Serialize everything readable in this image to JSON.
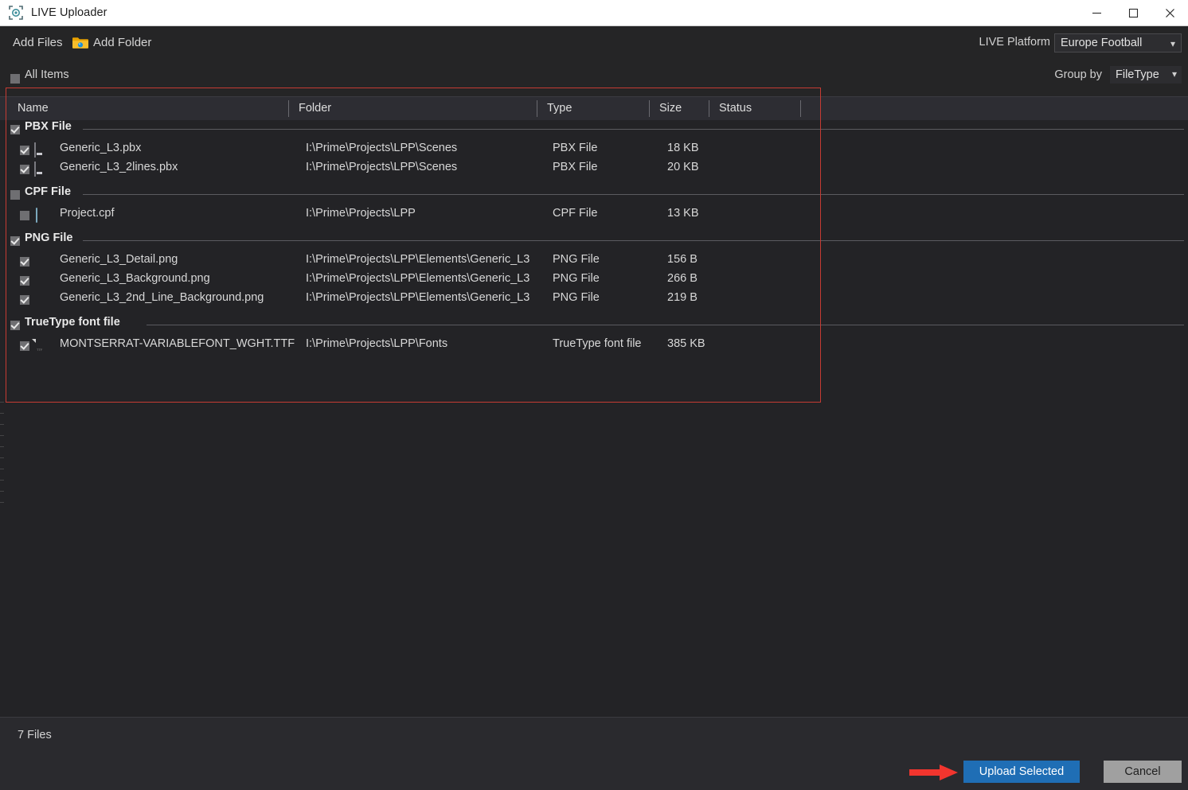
{
  "window": {
    "title": "LIVE Uploader",
    "app_icon": "viewfinder-icon",
    "minimize_label": "Minimize",
    "maximize_label": "Maximize",
    "close_label": "Close"
  },
  "toolbar": {
    "add_files_label": "Add Files",
    "add_folder_label": "Add Folder",
    "folder_icon": "folder-icon",
    "live_platform_label": "LIVE Platform",
    "live_platform_value": "Europe Football"
  },
  "filters": {
    "all_items_label": "All Items",
    "all_items_checked": false,
    "group_by_label": "Group by",
    "group_by_value": "FileType"
  },
  "table": {
    "columns": [
      "Name",
      "Folder",
      "Type",
      "Size",
      "Status"
    ],
    "groups": [
      {
        "label": "PBX File",
        "checked": true,
        "rows": [
          {
            "icon": "pbx-file-icon",
            "checked": true,
            "name": "Generic_L3.pbx",
            "folder": "I:\\Prime\\Projects\\LPP\\Scenes",
            "type": "PBX File",
            "size": "18 KB",
            "status": ""
          },
          {
            "icon": "pbx-file-icon",
            "checked": true,
            "name": "Generic_L3_2lines.pbx",
            "folder": "I:\\Prime\\Projects\\LPP\\Scenes",
            "type": "PBX File",
            "size": "20 KB",
            "status": ""
          }
        ]
      },
      {
        "label": "CPF File",
        "checked": false,
        "rows": [
          {
            "icon": "cpf-file-icon",
            "checked": false,
            "name": "Project.cpf",
            "folder": "I:\\Prime\\Projects\\LPP",
            "type": "CPF File",
            "size": "13 KB",
            "status": ""
          }
        ]
      },
      {
        "label": "PNG File",
        "checked": true,
        "rows": [
          {
            "icon": "png-bar-icon",
            "checked": true,
            "name": "Generic_L3_Detail.png",
            "folder": "I:\\Prime\\Projects\\LPP\\Elements\\Generic_L3",
            "type": "PNG File",
            "size": "156 B",
            "status": ""
          },
          {
            "icon": "png-line-icon",
            "checked": true,
            "name": "Generic_L3_Background.png",
            "folder": "I:\\Prime\\Projects\\LPP\\Elements\\Generic_L3",
            "type": "PNG File",
            "size": "266 B",
            "status": ""
          },
          {
            "icon": "png-line-icon",
            "checked": true,
            "name": "Generic_L3_2nd_Line_Background.png",
            "folder": "I:\\Prime\\Projects\\LPP\\Elements\\Generic_L3",
            "type": "PNG File",
            "size": "219 B",
            "status": ""
          }
        ]
      },
      {
        "label": "TrueType font file",
        "checked": true,
        "rows": [
          {
            "icon": "ttf-file-icon",
            "checked": true,
            "name": "MONTSERRAT-VARIABLEFONT_WGHT.TTF",
            "folder": "I:\\Prime\\Projects\\LPP\\Fonts",
            "type": "TrueType font file",
            "size": "385 KB",
            "status": ""
          }
        ]
      }
    ]
  },
  "status": {
    "file_count_text": "7 Files"
  },
  "footer": {
    "upload_label": "Upload Selected",
    "cancel_label": "Cancel",
    "annotation_arrow": "red-arrow-pointing-right"
  },
  "colors": {
    "accent_blue": "#1f6eb5",
    "annotation_red": "#f2352e",
    "annotation_rect_red": "#c63b33",
    "window_bg": "#252526",
    "list_bg": "#232326",
    "header_bg": "#2d2d33"
  }
}
